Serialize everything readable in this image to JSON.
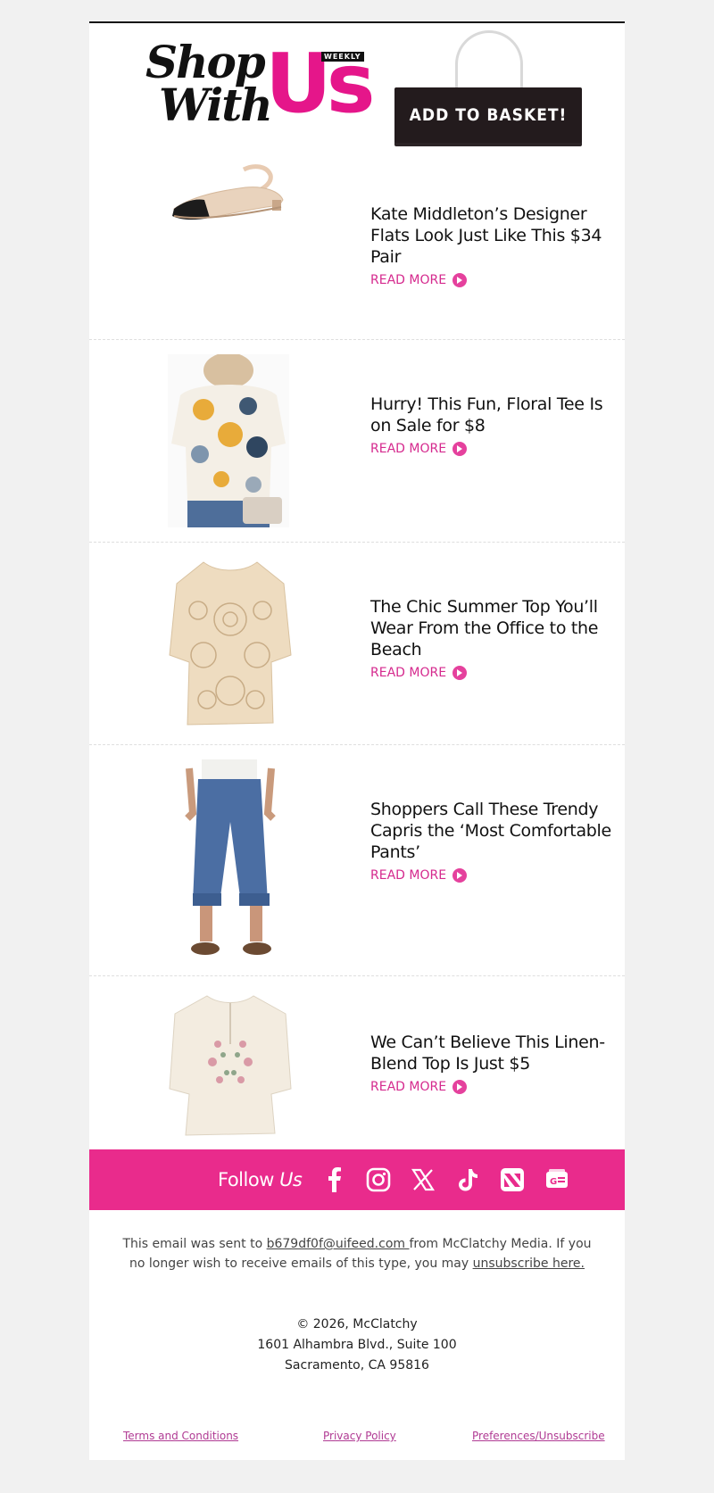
{
  "header": {
    "logo_shop": "Shop",
    "logo_with": "With",
    "logo_us": "Us",
    "logo_weekly": "WEEKLY",
    "bag_label": "ADD TO BASKET!"
  },
  "articles": [
    {
      "title": "Kate Middleton’s Designer Flats Look Just Like This $34 Pair",
      "cta": "READ MORE",
      "image": "slingback-flat"
    },
    {
      "title": "Hurry! This Fun, Floral Tee Is on Sale for $8",
      "cta": "READ MORE",
      "image": "floral-tee"
    },
    {
      "title": "The Chic Summer Top You’ll Wear From the Office to the Beach",
      "cta": "READ MORE",
      "image": "crochet-top"
    },
    {
      "title": "Shoppers Call These Trendy Capris the ‘Most Comfortable Pants’",
      "cta": "READ MORE",
      "image": "capri-pants"
    },
    {
      "title": "We Can’t Believe This Linen-Blend Top Is Just $5",
      "cta": "READ MORE",
      "image": "linen-top"
    }
  ],
  "follow": {
    "label_prefix": "Follow",
    "label_us": "Us",
    "icons": [
      "facebook-icon",
      "instagram-icon",
      "x-icon",
      "tiktok-icon",
      "apple-news-icon",
      "google-news-icon"
    ]
  },
  "footer": {
    "note_prefix": "This email was sent to ",
    "email": "b679df0f@uifeed.com ",
    "note_middle": "from McClatchy Media. If you no longer wish to receive emails of this type, you may ",
    "unsubscribe": "unsubscribe here.",
    "copyright": "© 2026, McClatchy",
    "address_line1": "1601 Alhambra Blvd., Suite 100",
    "address_line2": "Sacramento, CA 95816",
    "links": [
      "Terms and Conditions",
      "Privacy Policy",
      "Preferences/Unsubscribe"
    ]
  },
  "colors": {
    "brand_pink": "#e92b8c",
    "link_pink": "#d52a8e",
    "page_bg": "#f1f1f1"
  }
}
